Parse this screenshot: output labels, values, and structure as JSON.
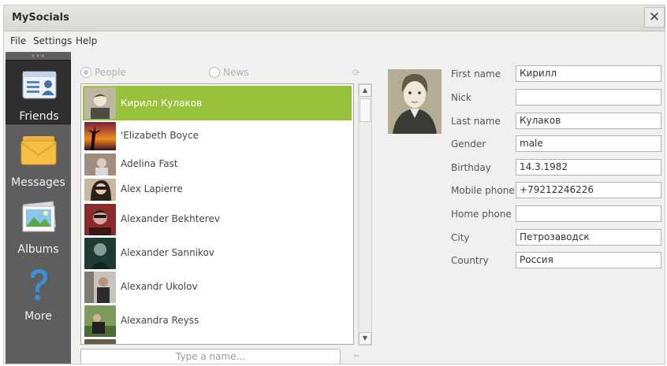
{
  "window": {
    "title": "MySocials",
    "close_label": "✕"
  },
  "menu": {
    "file": "File",
    "settings": "Settings",
    "help": "Help"
  },
  "sidebar": {
    "grip": "•••",
    "items": [
      {
        "label": "Friends",
        "icon": "contacts-icon",
        "active": true
      },
      {
        "label": "Messages",
        "icon": "envelope-icon"
      },
      {
        "label": "Albums",
        "icon": "photos-icon"
      },
      {
        "label": "More",
        "icon": "question-icon"
      }
    ]
  },
  "filter": {
    "people": "People",
    "news": "News",
    "selected": "People"
  },
  "friends": [
    {
      "name": "Кирилл Кулаков",
      "selected": true
    },
    {
      "name": "'Elizabeth Boyce"
    },
    {
      "name": "Adelina Fast"
    },
    {
      "name": "Alex Lapierre"
    },
    {
      "name": "Alexander Bekhterev"
    },
    {
      "name": "Alexander Sannikov"
    },
    {
      "name": "Alexandr Ukolov"
    },
    {
      "name": "Alexandra Reyss"
    }
  ],
  "search": {
    "placeholder": "Type a name..."
  },
  "profile": {
    "fields": [
      {
        "label": "First name",
        "value": "Кирилл"
      },
      {
        "label": "Nick",
        "value": ""
      },
      {
        "label": "Last name",
        "value": "Кулаков"
      },
      {
        "label": "Gender",
        "value": "male"
      },
      {
        "label": "Birthday",
        "value": "14.3.1982"
      },
      {
        "label": "Mobile phone",
        "value": "+79212246226"
      },
      {
        "label": "Home phone",
        "value": ""
      },
      {
        "label": "City",
        "value": "Петрозаводск"
      },
      {
        "label": "Country",
        "value": "Россия"
      }
    ]
  },
  "colors": {
    "selection": "#99c23c",
    "sidebar": "#5e5e5e",
    "sidebar_active": "#2f2f2f"
  }
}
